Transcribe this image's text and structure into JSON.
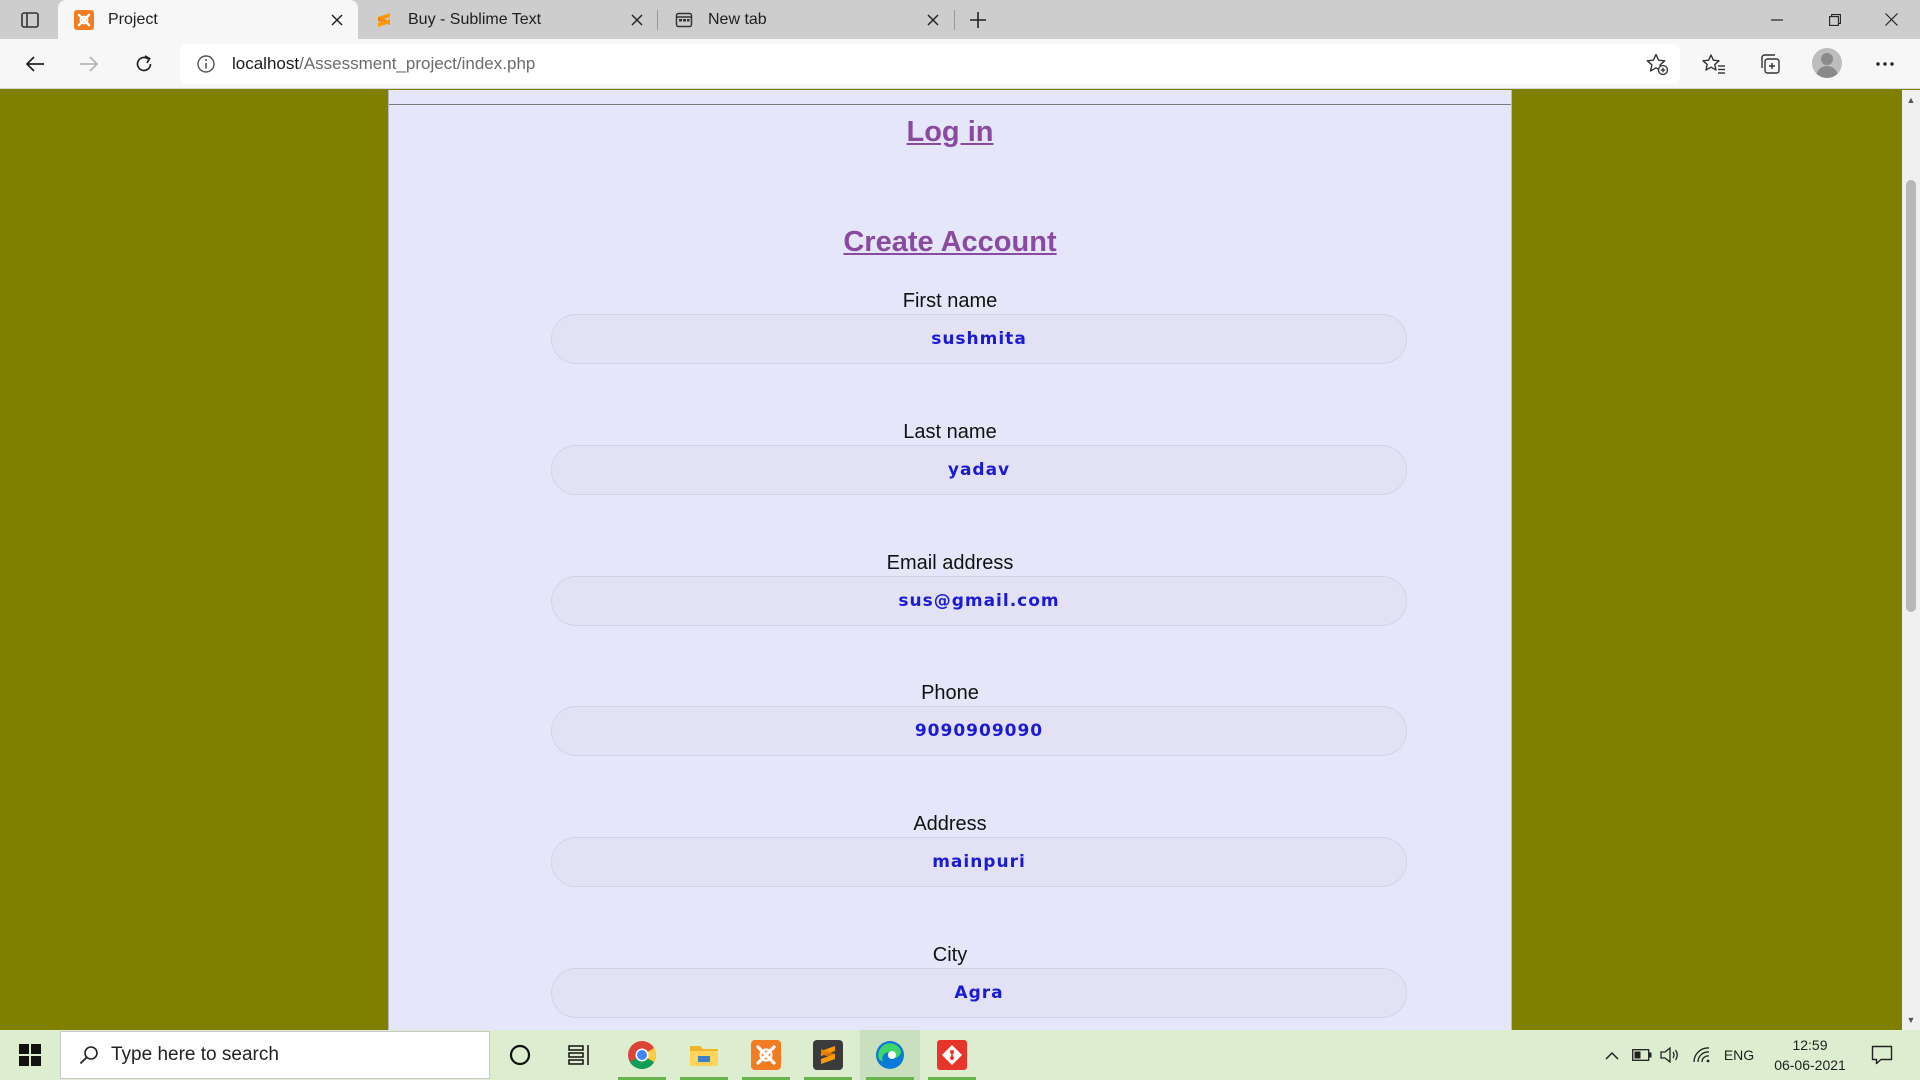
{
  "browser": {
    "tabs": [
      {
        "title": "Project",
        "active": true
      },
      {
        "title": "Buy - Sublime Text",
        "active": false
      },
      {
        "title": "New tab",
        "active": false
      }
    ],
    "url": {
      "host": "localhost",
      "path": "/Assessment_project/index.php"
    }
  },
  "page": {
    "login_link": "Log in",
    "create_account_link": "Create Account",
    "fields": [
      {
        "label": "First name",
        "value": "sushmita"
      },
      {
        "label": "Last name",
        "value": "yadav"
      },
      {
        "label": "Email address",
        "value": "sus@gmail.com"
      },
      {
        "label": "Phone",
        "value": "9090909090"
      },
      {
        "label": "Address",
        "value": "mainpuri"
      },
      {
        "label": "City",
        "value": "Agra"
      }
    ]
  },
  "taskbar": {
    "search_placeholder": "Type here to search",
    "language": "ENG",
    "time": "12:59",
    "date": "06-06-2021",
    "apps": [
      "cortana-icon",
      "task-view-icon",
      "chrome-icon",
      "file-explorer-icon",
      "xampp-icon",
      "sublime-text-icon",
      "edge-icon",
      "git-icon"
    ]
  },
  "colors": {
    "page_background": "#808000",
    "panel_background": "#e6e6fa",
    "link": "#8a4aa0",
    "input_text": "#1b1bd6"
  }
}
